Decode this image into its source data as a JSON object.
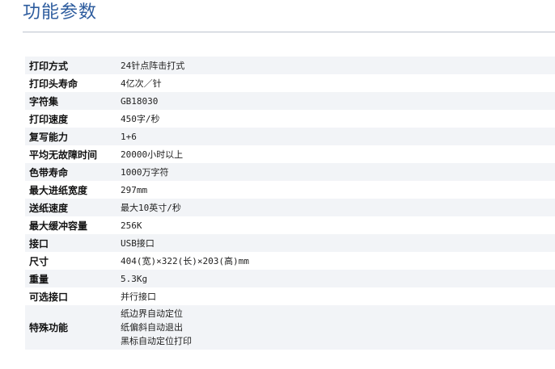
{
  "page": {
    "title": "功能参数"
  },
  "specs": [
    {
      "label": "打印方式",
      "value": [
        "24针点阵击打式"
      ]
    },
    {
      "label": "打印头寿命",
      "value": [
        "4亿次／针"
      ]
    },
    {
      "label": "字符集",
      "value": [
        "GB18030"
      ]
    },
    {
      "label": "打印速度",
      "value": [
        "450字/秒"
      ]
    },
    {
      "label": "复写能力",
      "value": [
        "1+6"
      ]
    },
    {
      "label": "平均无故障时间",
      "value": [
        "20000小时以上"
      ]
    },
    {
      "label": "色带寿命",
      "value": [
        "1000万字符"
      ]
    },
    {
      "label": "最大进纸宽度",
      "value": [
        "297mm"
      ]
    },
    {
      "label": "送纸速度",
      "value": [
        "最大10英寸/秒"
      ]
    },
    {
      "label": "最大缓冲容量",
      "value": [
        "256K"
      ]
    },
    {
      "label": "接口",
      "value": [
        "USB接口"
      ]
    },
    {
      "label": "尺寸",
      "value": [
        "404(宽)×322(长)×203(高)mm"
      ]
    },
    {
      "label": "重量",
      "value": [
        "5.3Kg"
      ]
    },
    {
      "label": "可选接口",
      "value": [
        "并行接口"
      ]
    },
    {
      "label": "特殊功能",
      "value": [
        "纸边界自动定位",
        "纸偏斜自动退出",
        "黑标自动定位打印"
      ]
    }
  ]
}
